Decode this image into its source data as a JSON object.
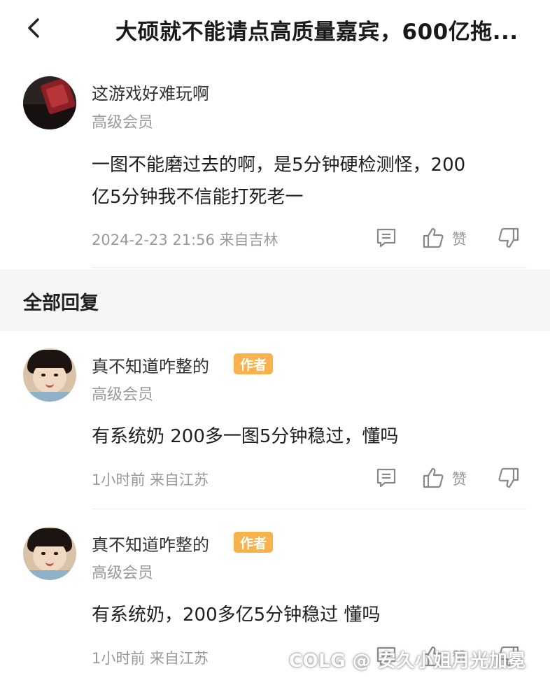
{
  "header": {
    "back_icon": "chevron-left-icon",
    "title": "大硕就不能请点高质量嘉宾，600亿拖..."
  },
  "post": {
    "username": "这游戏好难玩啊",
    "level": "高级会员",
    "content_line1": "一图不能磨过去的啊，是5分钟硬检测怪，200",
    "content_line2": "亿5分钟我不信能打死老一",
    "meta": "2024-2-23 21:56  来自吉林",
    "like_label": "赞"
  },
  "replies_section": {
    "title": "全部回复"
  },
  "replies": [
    {
      "username": "真不知道咋整的",
      "badge": "作者",
      "level": "高级会员",
      "content": "有系统奶 200多一图5分钟稳过，懂吗",
      "meta": "1小时前 来自江苏",
      "like_label": "赞"
    },
    {
      "username": "真不知道咋整的",
      "badge": "作者",
      "level": "高级会员",
      "content": "有系统奶，200多亿5分钟稳过  懂吗",
      "meta": "1小时前 来自江苏",
      "like_label": "赞"
    }
  ],
  "watermark": "COLG @ 安久小姐月光加冕",
  "colors": {
    "badge": "#f7b24c",
    "section_bg": "#f6f6f6",
    "meta_text": "#999999"
  }
}
